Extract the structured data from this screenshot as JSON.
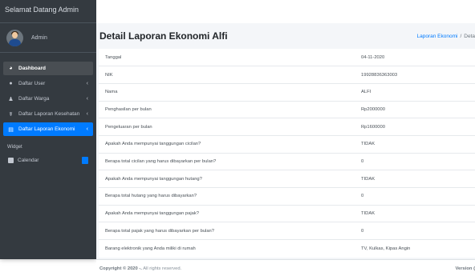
{
  "brand": {
    "title": "Selamat Datang Admin"
  },
  "user": {
    "name": "Admin"
  },
  "sidebar": {
    "items": [
      {
        "label": "Dashboard",
        "icon": "dashboard-icon"
      },
      {
        "label": "Daftar User",
        "icon": "user-icon",
        "chevron": "‹"
      },
      {
        "label": "Daftar Warga",
        "icon": "users-icon",
        "chevron": "‹"
      },
      {
        "label": "Daftar Laporan Kesehatan",
        "icon": "health-icon",
        "chevron": "‹"
      },
      {
        "label": "Daftar Laporan Ekonomi",
        "icon": "file-icon",
        "chevron": "‹"
      }
    ],
    "widget_header": "Widget",
    "calendar_label": "Calendar"
  },
  "header": {
    "title": "Detail Laporan Ekonomi Alfi",
    "breadcrumb": {
      "link": "Laporan Ekonomi",
      "separator": "/",
      "current": "Deta"
    }
  },
  "details": {
    "rows": [
      {
        "label": "Tanggal",
        "value": "04-11-2020"
      },
      {
        "label": "NIK",
        "value": "19928836363003"
      },
      {
        "label": "Nama",
        "value": "ALFI"
      },
      {
        "label": "Penghasilan per bulan",
        "value": "Rp2000000"
      },
      {
        "label": "Pengeluaran per bulan",
        "value": "Rp1600000"
      },
      {
        "label": "Apakah Anda mempunyai tanggungan cicilan?",
        "value": "TIDAK"
      },
      {
        "label": "Berapa total cicilan yang harus dibayarkan per bulan?",
        "value": "0"
      },
      {
        "label": "Apakah Anda mempunyai tanggungan hutang?",
        "value": "TIDAK"
      },
      {
        "label": "Berapa total hutang yang harus dibayarkan?",
        "value": "0"
      },
      {
        "label": "Apakah Anda mempunyai tanggungan pajak?",
        "value": "TIDAK"
      },
      {
        "label": "Berapa total pajak yang harus dibayarkan per bulan?",
        "value": "0"
      },
      {
        "label": "Barang elektronik yang Anda miliki di rumah",
        "value": "TV, Kulkas, Kipas Angin"
      }
    ]
  },
  "footer": {
    "copyright_strong": "Copyright © 2020 -.",
    "copyright_rest": " All rights reserved.",
    "version": "Version ("
  },
  "colors": {
    "sidebar_bg": "#343a40",
    "accent": "#007bff",
    "active_gray": "#494e53",
    "page_bg": "#f4f6f9"
  }
}
